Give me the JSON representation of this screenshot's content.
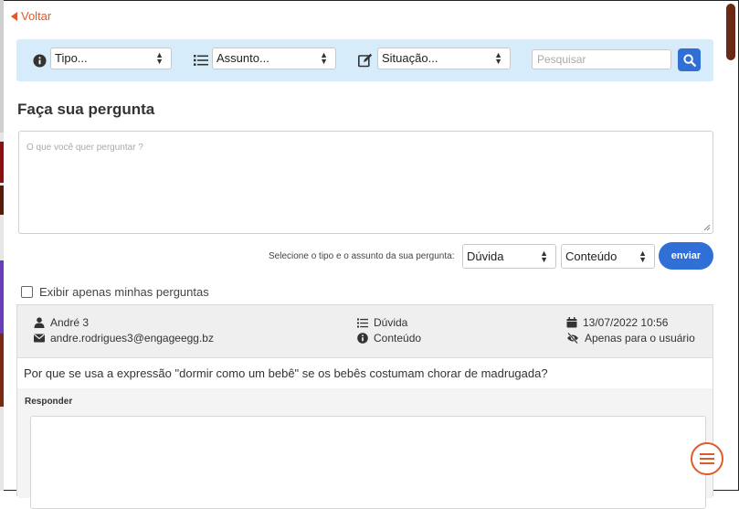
{
  "nav": {
    "back_label": "Voltar"
  },
  "filters": {
    "tipo": "Tipo...",
    "assunto": "Assunto...",
    "situacao": "Situação...",
    "search_placeholder": "Pesquisar"
  },
  "form": {
    "title": "Faça sua pergunta",
    "placeholder": "O que você quer perguntar ?",
    "hint": "Selecione o tipo e o assunto da sua pergunta:",
    "type_value": "Dúvida",
    "subject_value": "Conteúdo",
    "send_label": "enviar"
  },
  "only_mine_label": "Exibir apenas minhas perguntas",
  "question": {
    "author": "André 3",
    "email": "andre.rodrigues3@engageegg.bz",
    "type": "Dúvida",
    "subject": "Conteúdo",
    "datetime": "13/07/2022 10:56",
    "visibility": "Apenas para o usuário",
    "text": "Por que se usa a expressão \"dormir como um bebê\" se os bebês costumam chorar de madrugada?",
    "reply_label": "Responder"
  },
  "colors": {
    "accent": "#e05a2b",
    "primary": "#2f6fd6",
    "filter_bg": "#d7ecfb"
  }
}
